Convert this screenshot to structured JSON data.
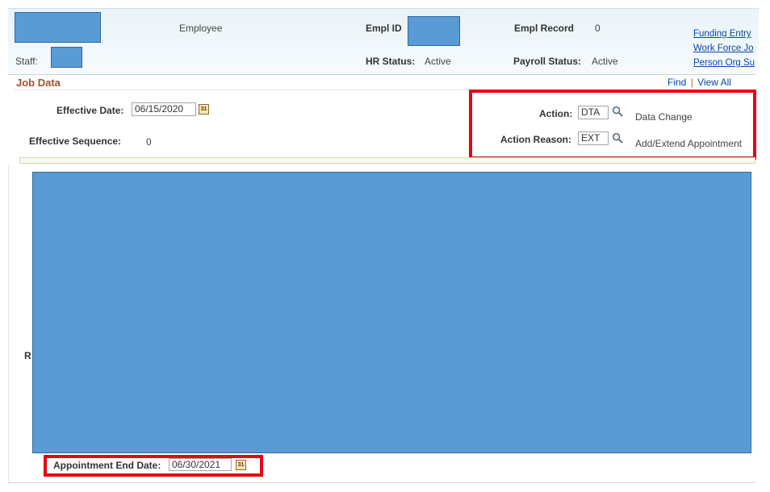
{
  "header": {
    "employee_label": "Employee",
    "empl_id_label": "Empl ID",
    "empl_record_label": "Empl Record",
    "empl_record_value": "0",
    "staff_label": "Staff:",
    "hr_status_label": "HR Status:",
    "hr_status_value": "Active",
    "payroll_status_label": "Payroll Status:",
    "payroll_status_value": "Active",
    "links": [
      "Funding Entry",
      "Work Force Jo",
      "Person Org Su"
    ]
  },
  "section": {
    "title": "Job Data",
    "find_label": "Find",
    "divider": "|",
    "view_all_label": "View All"
  },
  "form": {
    "effective_date_label": "Effective Date:",
    "effective_date_value": "06/15/2020",
    "effective_sequence_label": "Effective Sequence:",
    "effective_sequence_value": "0",
    "action_label": "Action:",
    "action_value": "DTA",
    "action_description": "Data Change",
    "action_reason_label": "Action Reason:",
    "action_reason_value": "EXT",
    "action_reason_description": "Add/Extend Appointment",
    "partial_label": "R",
    "appointment_end_date_label": "Appointment End Date:",
    "appointment_end_date_value": "06/30/2021"
  },
  "icons": {
    "calendar": "calendar-icon",
    "lookup": "magnifier-icon",
    "calendar_glyph": "31"
  },
  "colors": {
    "redaction": "#5b9bd5",
    "highlight_box": "#e30613",
    "section_title": "#a0522d",
    "link": "#0645ad"
  }
}
